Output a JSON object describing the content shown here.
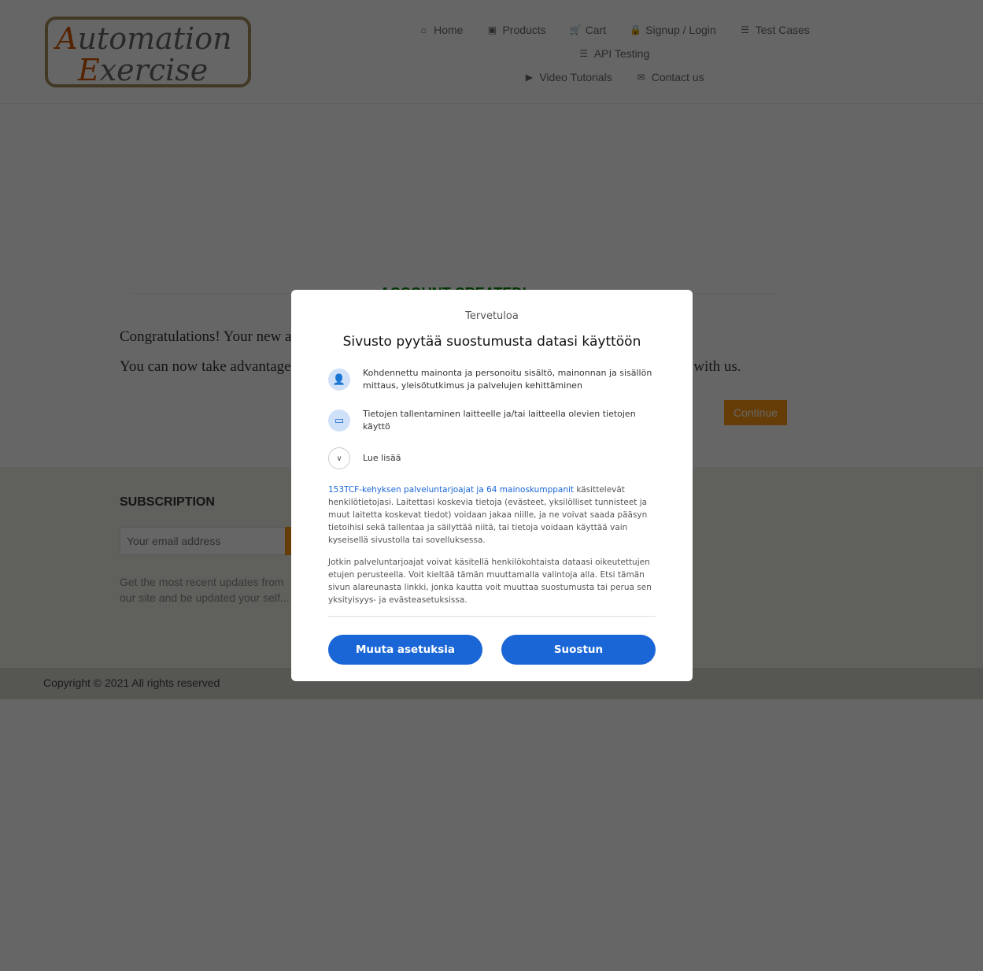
{
  "logo": {
    "line1_cap": "A",
    "line1_rest": "utomation",
    "line2_cap": "E",
    "line2_rest": "xercise"
  },
  "nav": [
    {
      "icon": "home-icon",
      "glyph": "⌂",
      "label": "Home"
    },
    {
      "icon": "briefcase-icon",
      "glyph": "▣",
      "label": "Products"
    },
    {
      "icon": "cart-icon",
      "glyph": "🛒",
      "label": "Cart"
    },
    {
      "icon": "lock-icon",
      "glyph": "🔒",
      "label": "Signup / Login"
    },
    {
      "icon": "list-icon",
      "glyph": "☰",
      "label": "Test Cases"
    },
    {
      "icon": "list-icon",
      "glyph": "☰",
      "label": "API Testing"
    },
    {
      "icon": "youtube-play-icon",
      "glyph": "▶",
      "label": "Video Tutorials"
    },
    {
      "icon": "envelope-icon",
      "glyph": "✉",
      "label": "Contact us"
    }
  ],
  "main": {
    "title": "ACCOUNT CREATED!",
    "message1": "Congratulations! Your new account has been successfully created!",
    "message2": "You can now take advantage of member privileges to enhance your online shopping experience with us.",
    "continue_label": "Continue"
  },
  "footer": {
    "subscription_title": "SUBSCRIPTION",
    "email_placeholder": "Your email address",
    "subscription_text": "Get the most recent updates from our site and be updated your self...",
    "copyright": "Copyright © 2021 All rights reserved"
  },
  "consent": {
    "welcome": "Tervetuloa",
    "heading": "Sivusto pyytää suostumusta datasi käyttöön",
    "purposes": [
      {
        "icon": "person-icon",
        "text": "Kohdennettu mainonta ja personoitu sisältö, mainonnan ja sisällön mittaus, yleisötutkimus ja palvelujen kehittäminen"
      },
      {
        "icon": "devices-icon",
        "text": "Tietojen tallentaminen laitteelle ja/tai laitteella olevien tietojen käyttö"
      }
    ],
    "learn_more": "Lue lisää",
    "vendors_link": "153TCF-kehyksen palveluntarjoajat ja 64 mainoskumppanit",
    "paragraph1_rest": " käsittelevät henkilötietojasi. Laitettasi koskevia tietoja (evästeet, yksilölliset tunnisteet ja muut laitetta koskevat tiedot) voidaan jakaa niille, ja ne voivat saada pääsyn tietoihisi sekä tallentaa ja säilyttää niitä, tai tietoja voidaan käyttää vain kyseisellä sivustolla tai sovelluksessa.",
    "paragraph2": "Jotkin palveluntarjoajat voivat käsitellä henkilökohtaista dataasi oikeutettujen etujen perusteella. Voit kieltää tämän muuttamalla valintoja alla. Etsi tämän sivun alareunasta linkki, jonka kautta voit muuttaa suostumusta tai perua sen yksityisyys- ja evästeasetuksissa.",
    "manage_label": "Muuta asetuksia",
    "accept_label": "Suostun"
  },
  "colors": {
    "accent": "#FE980F",
    "success": "#008000",
    "consent_blue": "#1A66D6"
  }
}
